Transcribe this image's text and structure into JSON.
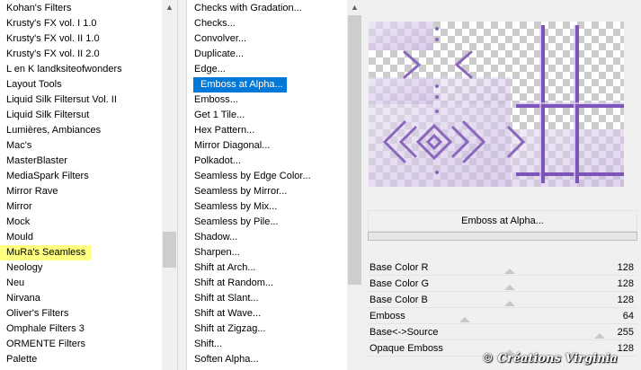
{
  "categories": {
    "items": [
      "Kohan's Filters",
      "Krusty's FX vol. I 1.0",
      "Krusty's FX vol. II 1.0",
      "Krusty's FX vol. II 2.0",
      "L en K landksiteofwonders",
      "Layout Tools",
      "Liquid Silk Filtersut Vol. II",
      "Liquid Silk Filtersut",
      "Lumières, Ambiances",
      "Mac's",
      "MasterBlaster",
      "MediaSpark Filters",
      "Mirror Rave",
      "Mirror",
      "Mock",
      "Mould",
      "MuRa's Seamless",
      "Neology",
      "Neu",
      "Nirvana",
      "Oliver's Filters",
      "Omphale Filters 3",
      "ORMENTE Filters",
      "Palette"
    ],
    "highlighted": "MuRa's Seamless"
  },
  "filters": {
    "items": [
      "Checks with Gradation...",
      "Checks...",
      "Convolver...",
      "Duplicate...",
      "Edge...",
      "Emboss at Alpha...",
      "Emboss...",
      "Get 1 Tile...",
      "Hex Pattern...",
      "Mirror Diagonal...",
      "Polkadot...",
      "Seamless by Edge Color...",
      "Seamless by Mirror...",
      "Seamless by Mix...",
      "Seamless by Pile...",
      "Shadow...",
      "Sharpen...",
      "Shift at Arch...",
      "Shift at Random...",
      "Shift at Slant...",
      "Shift at Wave...",
      "Shift at Zigzag...",
      "Shift...",
      "Soften Alpha..."
    ],
    "selected": "Emboss at Alpha..."
  },
  "filter_title": "Emboss at Alpha...",
  "params": [
    {
      "name": "Base Color R",
      "value": "128",
      "level": 0.5
    },
    {
      "name": "Base Color G",
      "value": "128",
      "level": 0.5
    },
    {
      "name": "Base Color B",
      "value": "128",
      "level": 0.5
    },
    {
      "name": "Emboss",
      "value": "64",
      "level": 0.25
    },
    {
      "name": "Base<->Source",
      "value": "255",
      "level": 1.0
    },
    {
      "name": "Opaque Emboss",
      "value": "128",
      "level": 0.5
    }
  ],
  "watermark": "© Créations Virginia",
  "colors": {
    "selection": "#0078d7",
    "highlight": "#ffff80",
    "preview_purple": "#9b7cc4"
  }
}
